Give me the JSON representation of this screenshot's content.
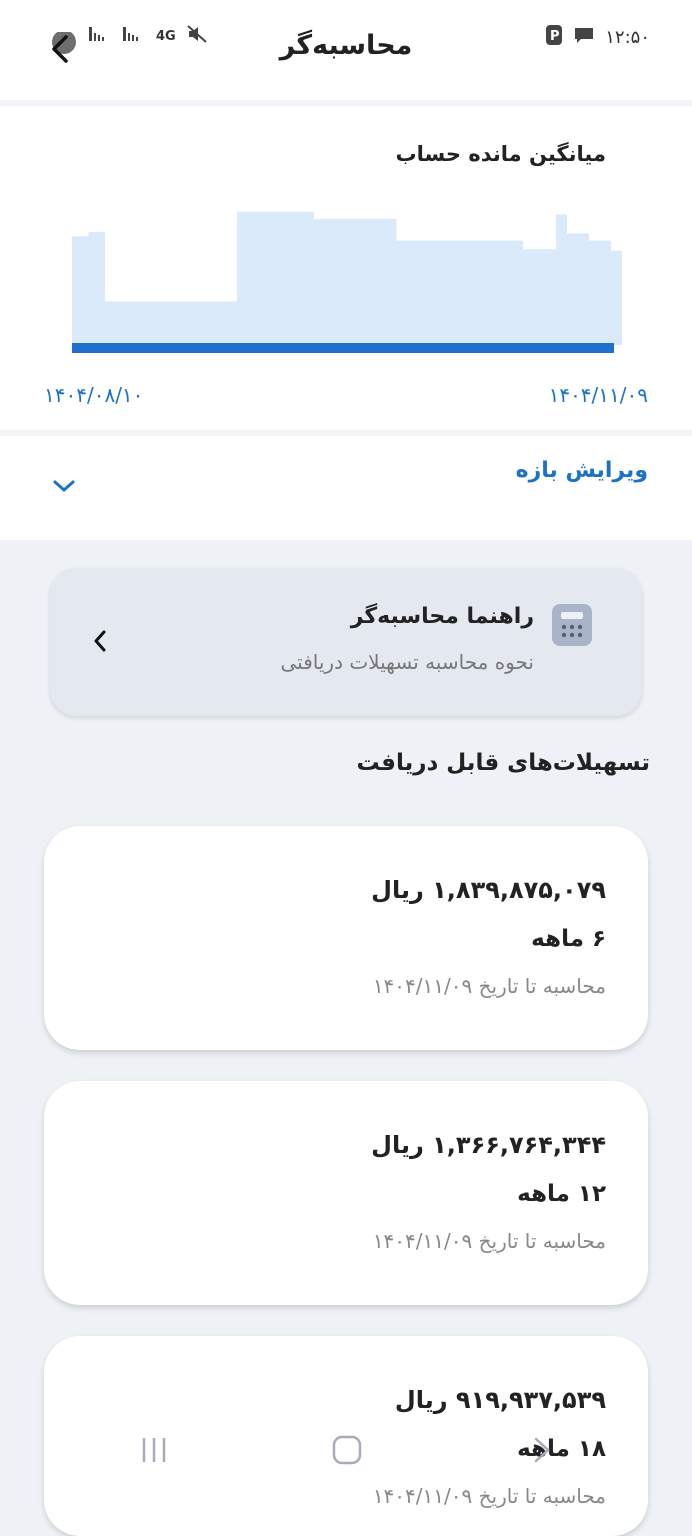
{
  "status_bar": {
    "time": "۱۲:۵۰",
    "network": "4G"
  },
  "header": {
    "title": "محاسبه‌گر"
  },
  "chart": {
    "title": "میانگین مانده حساب",
    "start_date": "۱۴۰۴/۰۸/۱۰",
    "end_date": "۱۴۰۴/۱۱/۰۹"
  },
  "chart_data": {
    "type": "area",
    "title": "میانگین مانده حساب",
    "x_range": [
      "۱۴۰۴/۰۸/۱۰",
      "۱۴۰۴/۱۱/۰۹"
    ],
    "x": [
      0,
      3,
      6,
      10,
      30,
      40,
      44,
      56,
      59,
      71,
      82,
      86,
      88,
      90,
      94,
      98,
      100
    ],
    "values": [
      0.75,
      0.78,
      0.3,
      0.3,
      0.92,
      0.92,
      0.87,
      0.87,
      0.72,
      0.72,
      0.66,
      0.66,
      0.9,
      0.77,
      0.72,
      0.65,
      0.63
    ],
    "ylim": [
      0,
      1
    ],
    "fill_color": "#dbeafb",
    "baseline_color": "#1f6fd1",
    "grid": false
  },
  "range": {
    "label": "ویرایش بازه"
  },
  "guide": {
    "title": "راهنما محاسبه‌گر",
    "subtitle": "نحوه محاسبه تسهیلات دریافتی"
  },
  "facilities": {
    "title": "تسهیلات‌های قابل دریافت",
    "items": [
      {
        "amount": "۱,۸۳۹,۸۷۵,۰۷۹ ریال",
        "term": "۶ ماهه",
        "calc": "محاسبه تا تاریخ ۱۴۰۴/۱۱/۰۹"
      },
      {
        "amount": "۱,۳۶۶,۷۶۴,۳۴۴ ریال",
        "term": "۱۲ ماهه",
        "calc": "محاسبه تا تاریخ ۱۴۰۴/۱۱/۰۹"
      },
      {
        "amount": "۹۱۹,۹۳۷,۵۳۹ ریال",
        "term": "۱۸ ماهه",
        "calc": "محاسبه تا تاریخ ۱۴۰۴/۱۱/۰۹"
      }
    ]
  },
  "colors": {
    "accent": "#1a73c8",
    "background": "#eef1f6"
  }
}
